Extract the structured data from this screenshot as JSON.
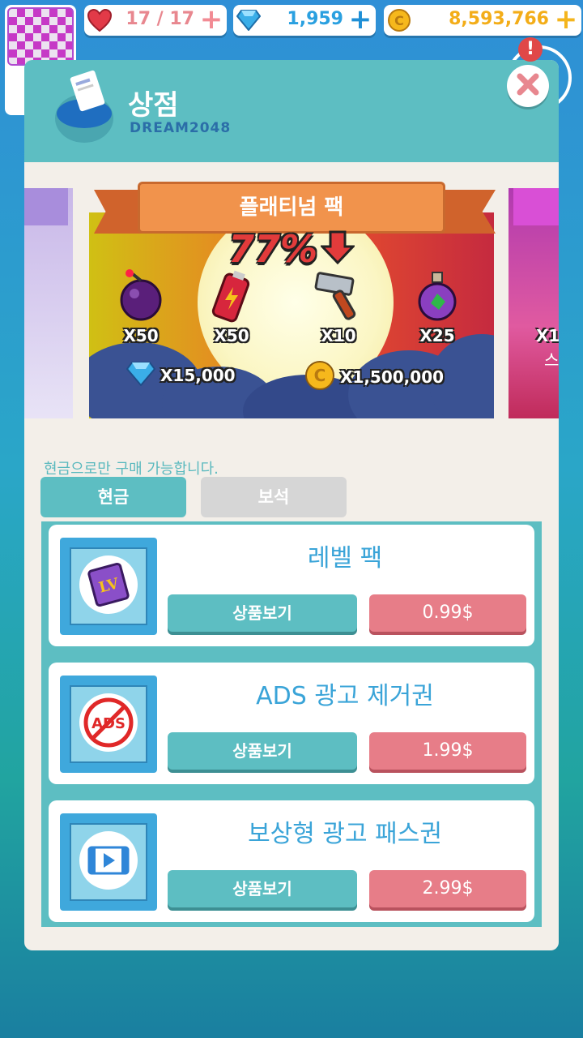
{
  "hud": {
    "lives": "17 / 17",
    "gems": "1,959",
    "coins": "8,593,766"
  },
  "modal": {
    "title": "상점",
    "subtitle": "DREAM2048"
  },
  "banner": {
    "title": "플래티넘 팩",
    "discount": "77%",
    "items": [
      {
        "icon": "bomb-icon",
        "qty": "X50"
      },
      {
        "icon": "battery-icon",
        "qty": "X50"
      },
      {
        "icon": "hammer-icon",
        "qty": "X10"
      },
      {
        "icon": "potion-icon",
        "qty": "X25"
      }
    ],
    "rewards": [
      {
        "icon": "gem-icon",
        "amount": "X15,000"
      },
      {
        "icon": "coin-icon",
        "amount": "X1,500,000"
      }
    ],
    "right_peek_qty": "X1",
    "right_peek_text": "스"
  },
  "cash_note": "현금으로만 구매 가능합니다.",
  "tabs": [
    {
      "label": "현금",
      "active": true
    },
    {
      "label": "보석",
      "active": false
    }
  ],
  "products": [
    {
      "name": "레벨 팩",
      "view_label": "상품보기",
      "price": "0.99$",
      "icon": "level-book-icon"
    },
    {
      "name": "ADS 광고 제거권",
      "view_label": "상품보기",
      "price": "1.99$",
      "icon": "no-ads-icon"
    },
    {
      "name": "보상형 광고 패스권",
      "view_label": "상품보기",
      "price": "2.99$",
      "icon": "video-icon"
    }
  ],
  "colors": {
    "accent": "#5dbec2",
    "price": "#e77d88",
    "title_blue": "#3aa4d8"
  }
}
